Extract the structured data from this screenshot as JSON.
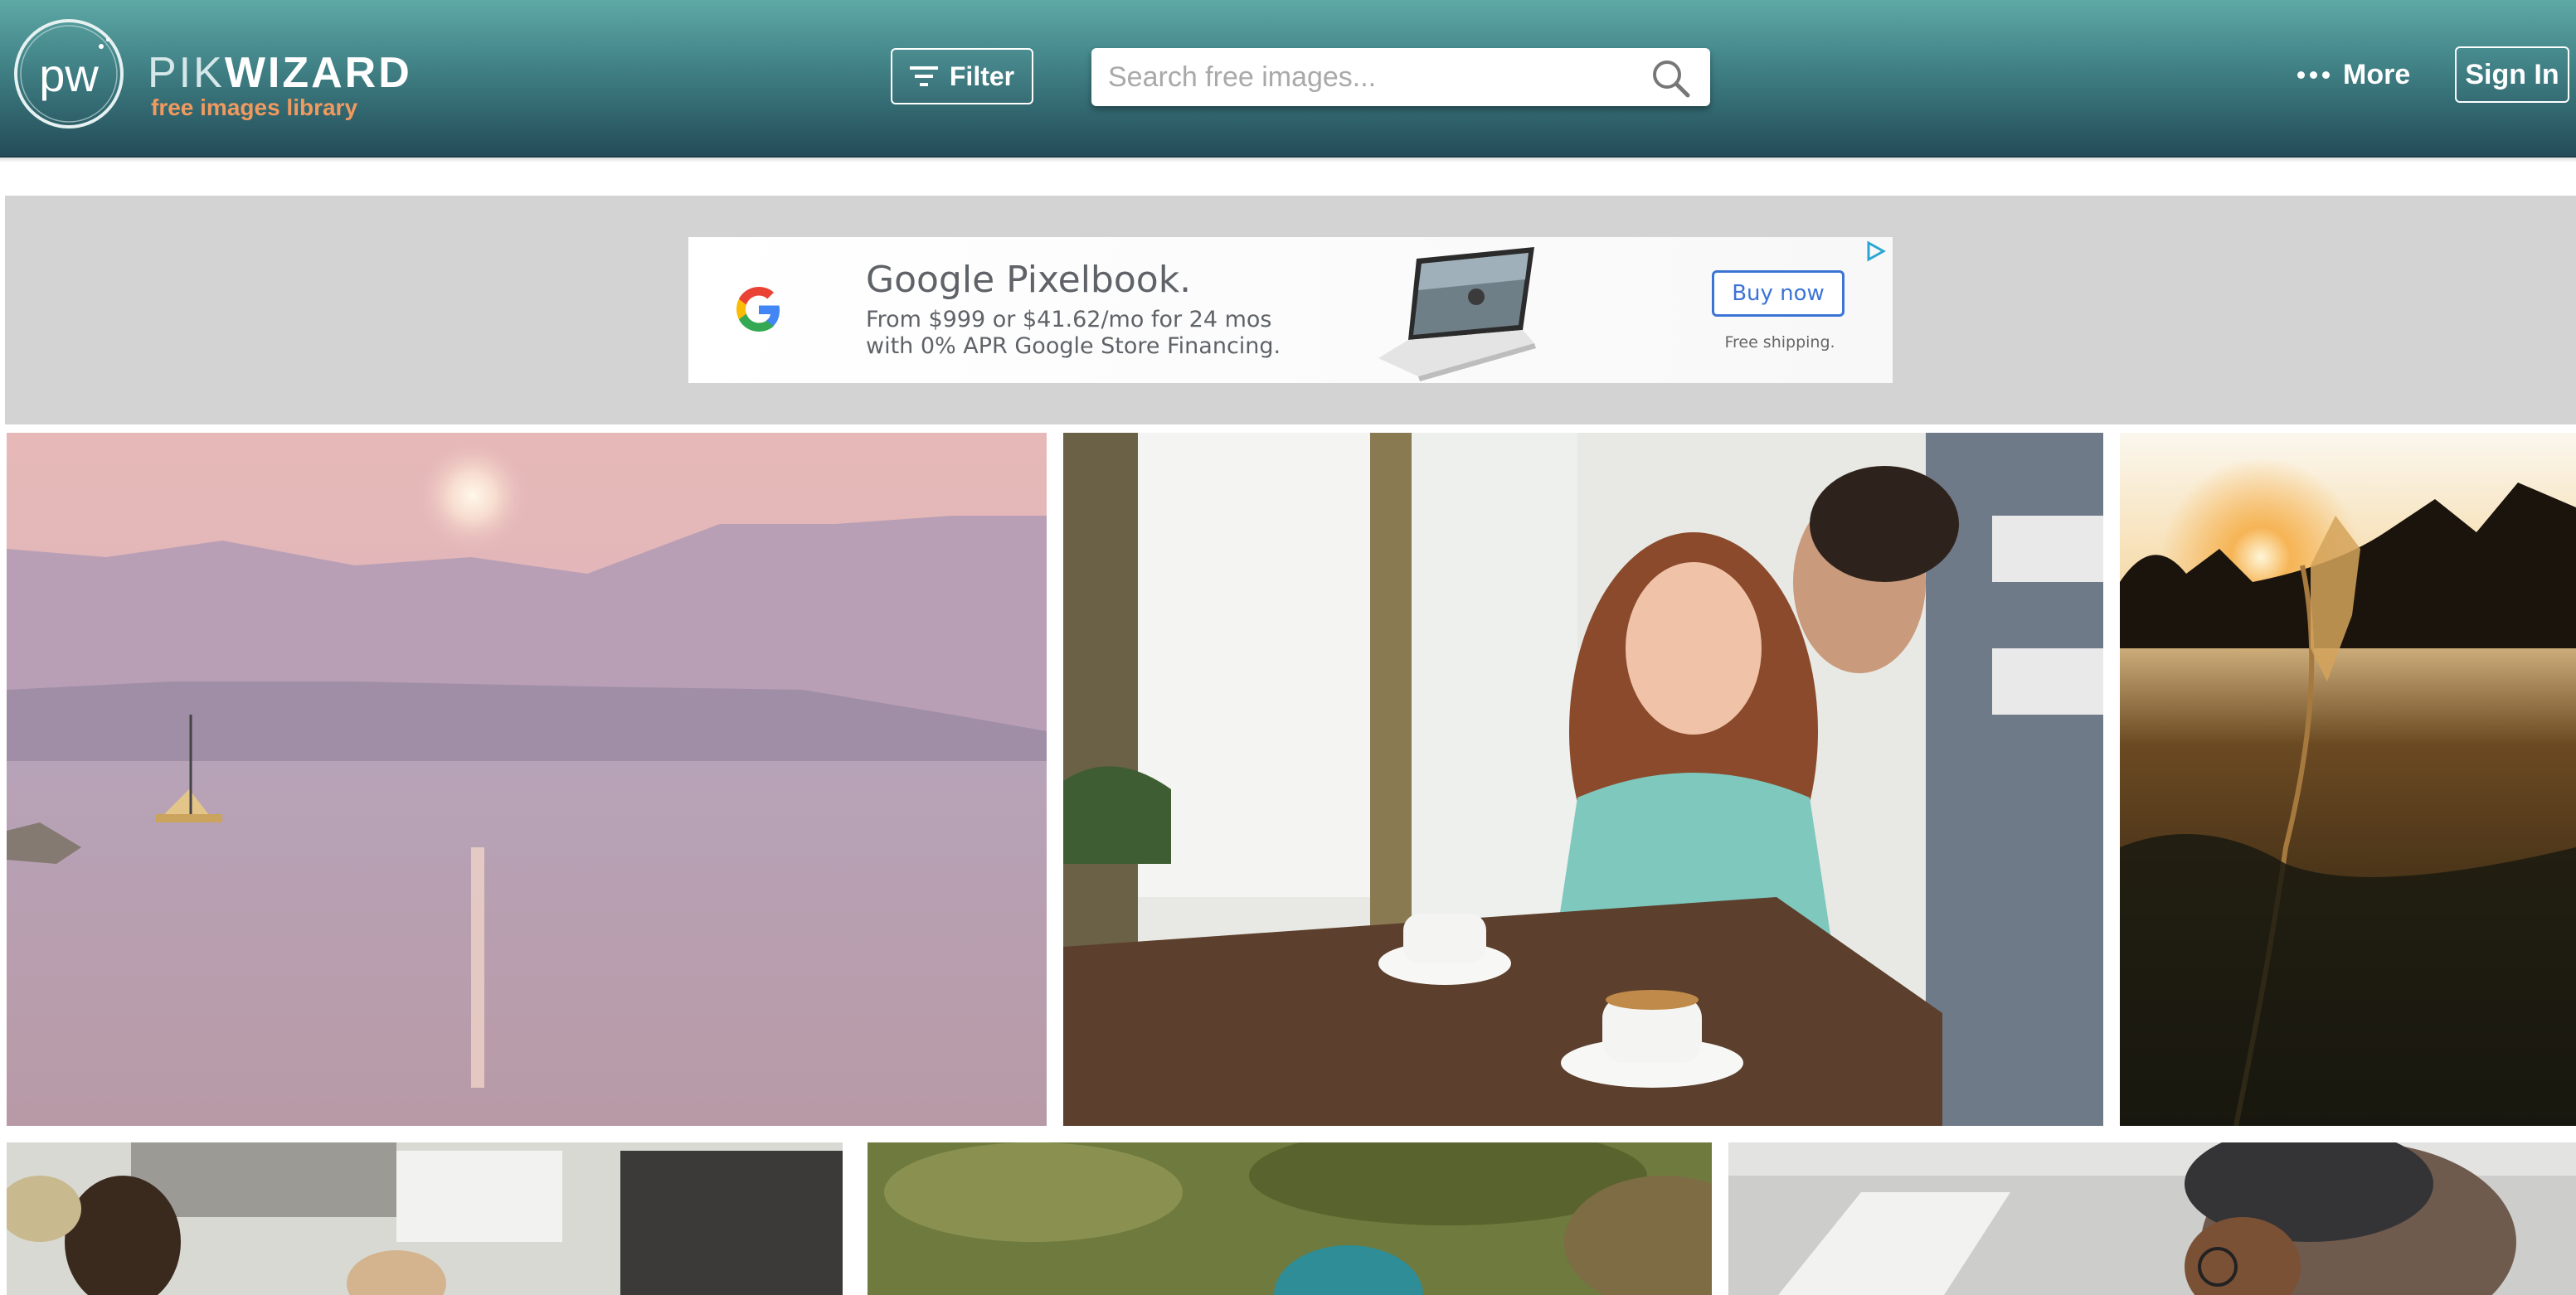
{
  "header": {
    "logo": {
      "monogram": "pw",
      "word_light": "PIK",
      "word_bold": "WIZARD",
      "tagline": "free images library"
    },
    "filter_label": "Filter",
    "search": {
      "placeholder": "Search free images...",
      "value": ""
    },
    "more_label": "More",
    "signin_label": "Sign In"
  },
  "ad": {
    "title": "Google Pixelbook.",
    "line1": "From $999 or $41.62/mo for 24 mos",
    "line2": "with 0% APR Google Store Financing.",
    "button_label": "Buy now",
    "shipping": "Free shipping.",
    "accent": "#3c74d6"
  },
  "theme": {
    "header_top": "#5ea8a6",
    "header_bottom": "#234b57",
    "tagline_color": "#f09a5f"
  },
  "photos": [
    {
      "name": "lake-sunset-sailboat"
    },
    {
      "name": "couple-cafe-coffee"
    },
    {
      "name": "wheat-field-sunset"
    },
    {
      "name": "street-people"
    },
    {
      "name": "forest-hat"
    },
    {
      "name": "person-beanie-glasses"
    }
  ]
}
